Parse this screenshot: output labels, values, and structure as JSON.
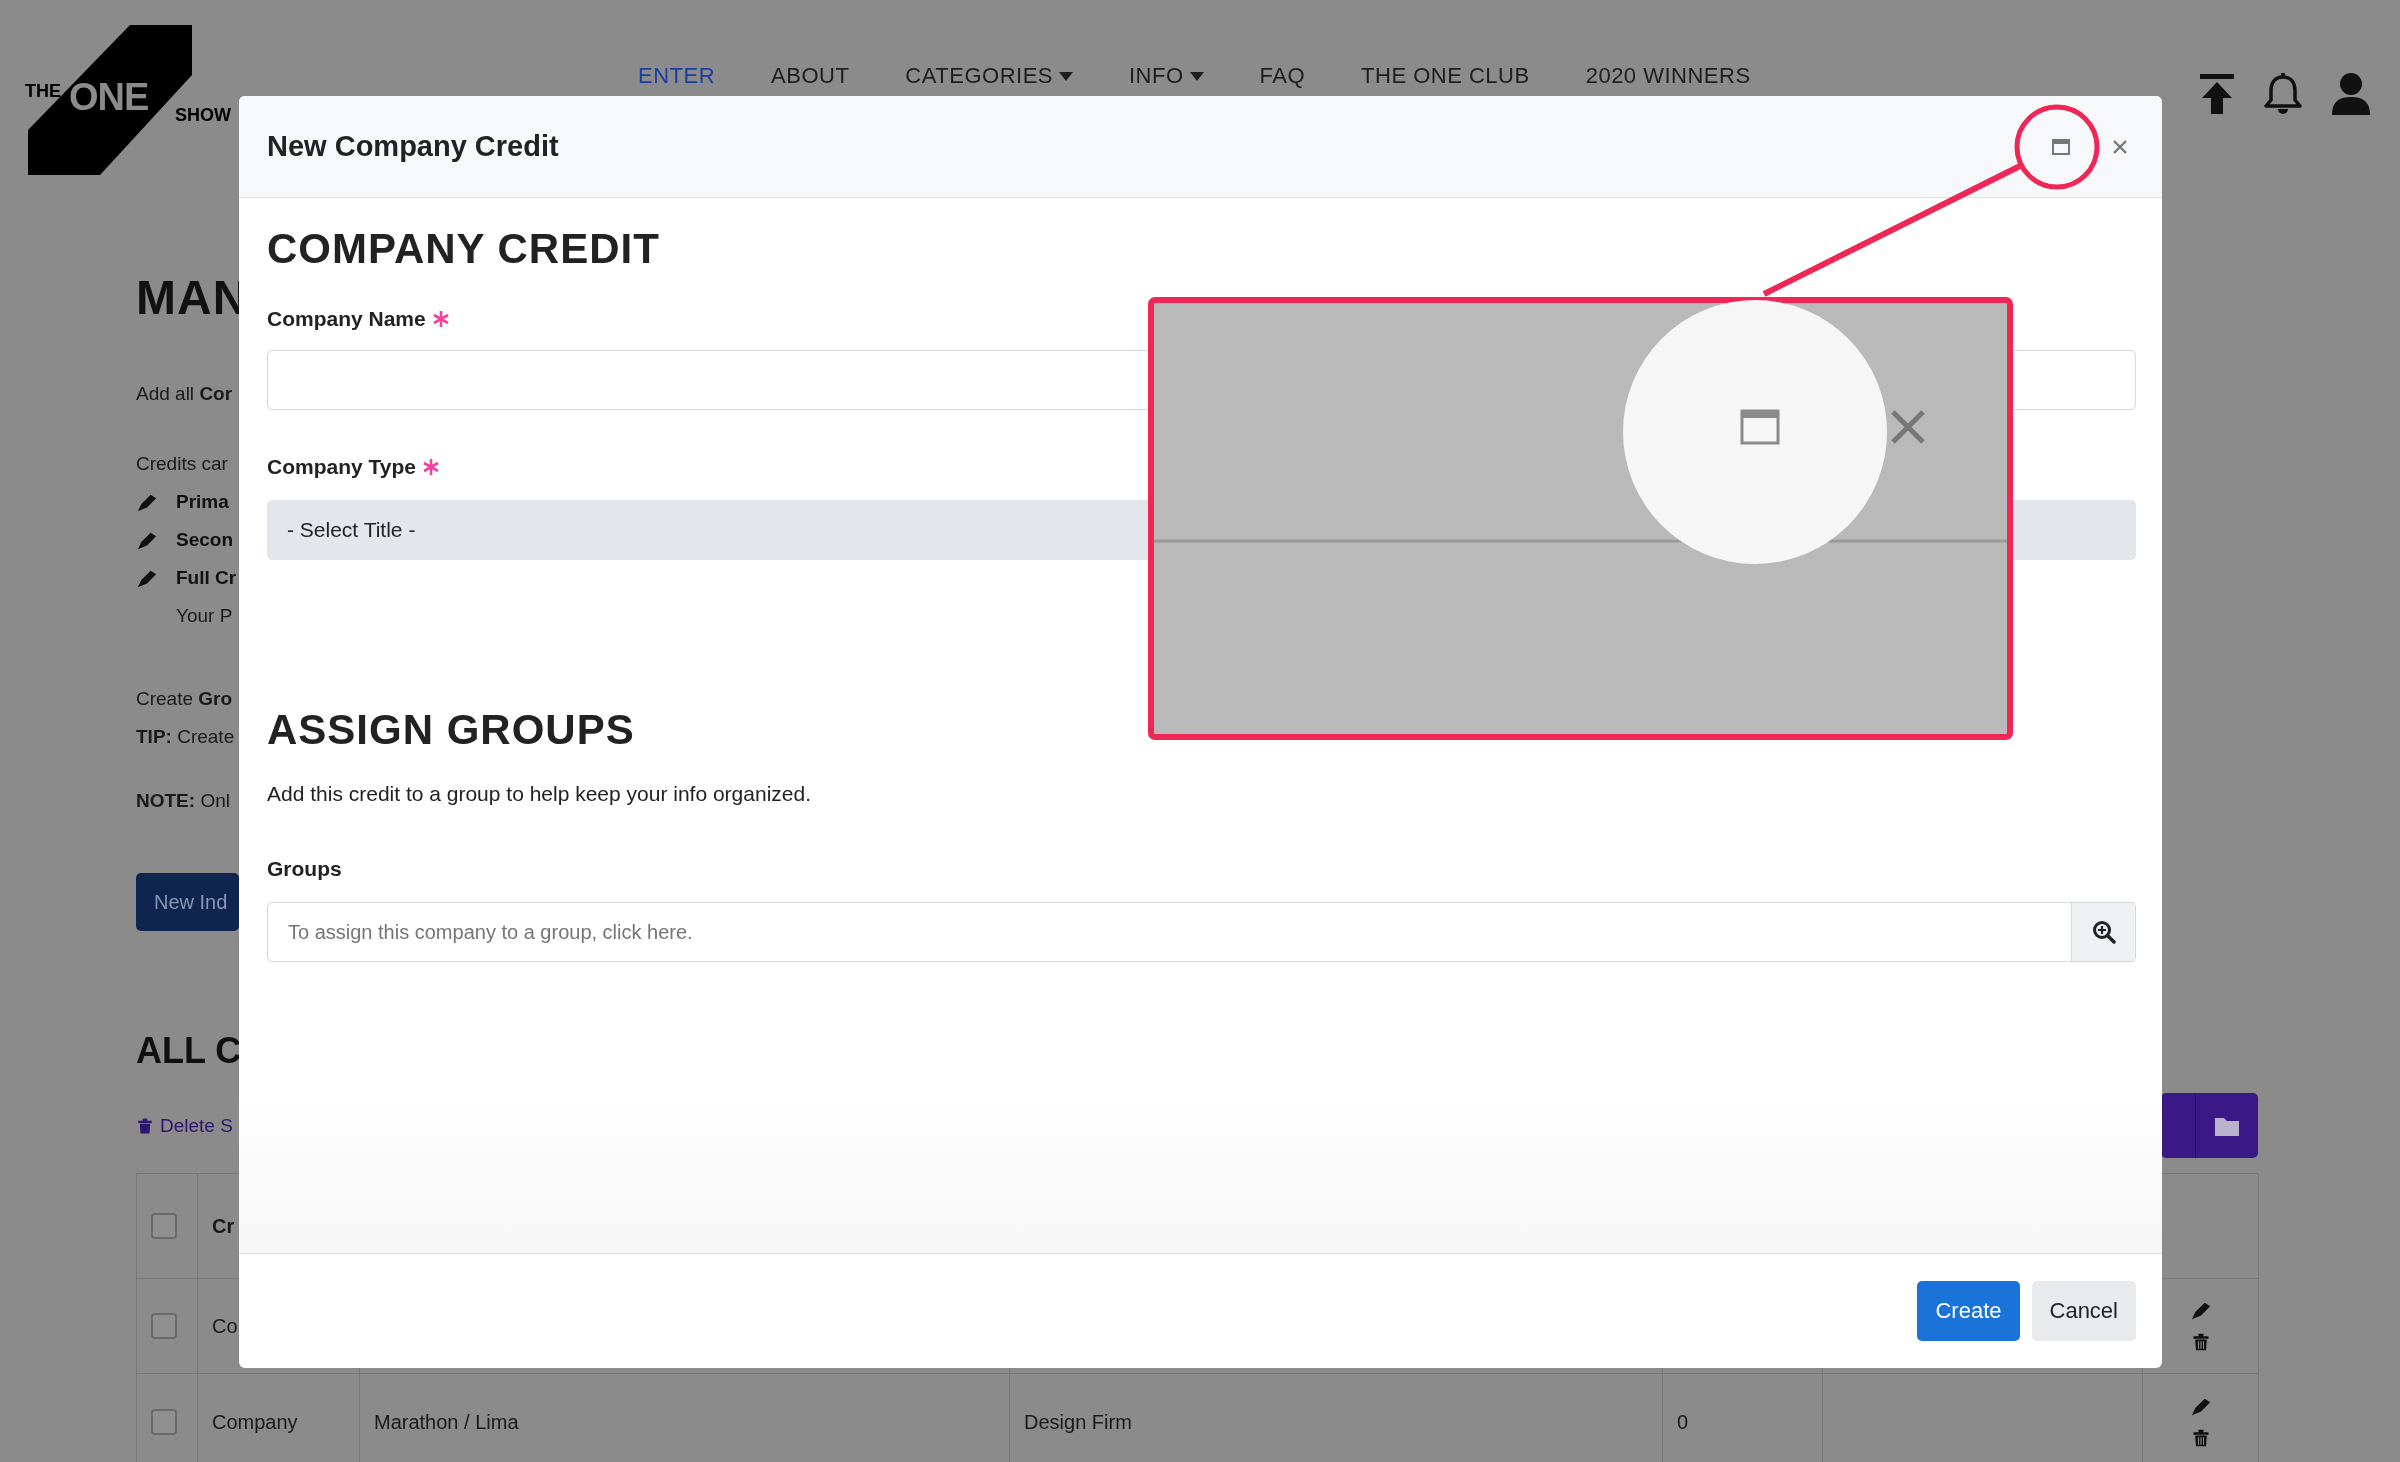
{
  "header": {
    "logo": [
      "THE",
      "ONE",
      "SHOW"
    ],
    "nav": [
      {
        "label": "ENTER",
        "selected": true,
        "dropdown": false
      },
      {
        "label": "ABOUT",
        "selected": false,
        "dropdown": false
      },
      {
        "label": "CATEGORIES",
        "selected": false,
        "dropdown": true
      },
      {
        "label": "INFO",
        "selected": false,
        "dropdown": true
      },
      {
        "label": "FAQ",
        "selected": false,
        "dropdown": false
      },
      {
        "label": "THE ONE CLUB",
        "selected": false,
        "dropdown": false
      },
      {
        "label": "2020 WINNERS",
        "selected": false,
        "dropdown": false
      }
    ]
  },
  "page": {
    "title": "MAN",
    "intro": "Add all **Cor**",
    "credits_intro": "Credits car",
    "credit_types": [
      {
        "label": "Prima"
      },
      {
        "label": "Secon"
      },
      {
        "label": "Full Cr",
        "note": "Your P"
      }
    ],
    "groups_text": "Create **Gro**",
    "tip": "**TIP:** Create",
    "note": "**NOTE:** Onl",
    "new_button": "New Ind",
    "list_title": "ALL C",
    "delete_link": "Delete S",
    "table": {
      "header": {
        "checked": false,
        "column_2": "Cr"
      },
      "rows": [
        {
          "checked": false,
          "column_2": "Co"
        },
        {
          "checked": false,
          "column_2": "Company",
          "column_3": "Marathon / Lima",
          "column_4": "Design Firm",
          "column_5": "0"
        }
      ]
    }
  },
  "modal": {
    "title": "New Company Credit",
    "section_title": "COMPANY CREDIT",
    "fields": [
      {
        "kind": "input",
        "label": "Company Name",
        "required": true
      },
      {
        "kind": "select",
        "label": "Company Type",
        "required": true,
        "value": "- Select Title -"
      }
    ],
    "groups_title": "ASSIGN GROUPS",
    "groups_description": "Add this credit to a group to help keep your info organized.",
    "groups_field": {
      "label": "Groups",
      "placeholder": "To assign this company to a group, click here."
    },
    "buttons": [
      {
        "kind": "primary",
        "label": "Create"
      },
      {
        "kind": "secondary",
        "label": "Cancel"
      }
    ]
  }
}
